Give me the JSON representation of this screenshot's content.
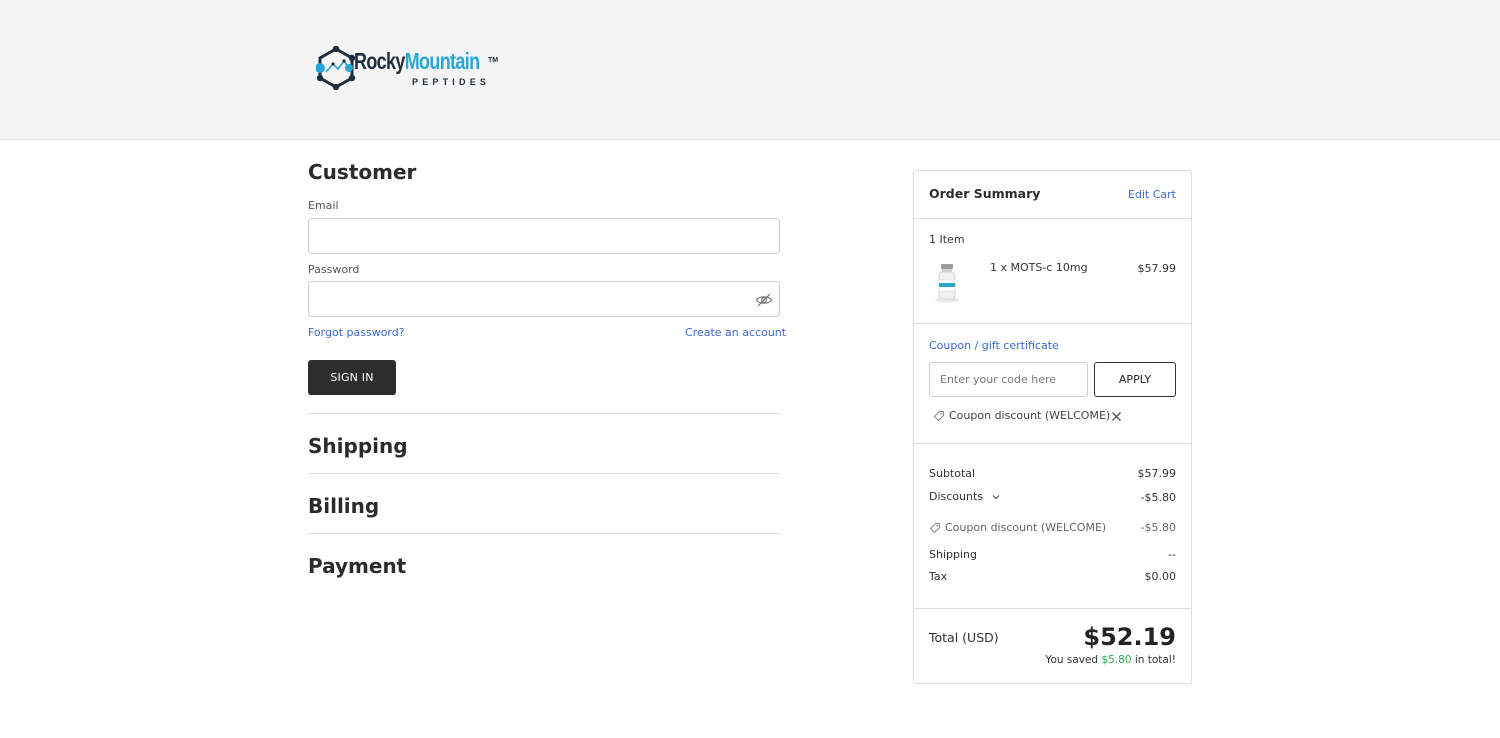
{
  "brand": {
    "logo_word_1": "Rocky",
    "logo_word_2": "Mountain",
    "logo_tm": "TM",
    "logo_sub": "PEPTIDES",
    "colors": {
      "dark": "#1f2d3d",
      "accent": "#2aa6d6"
    }
  },
  "customer": {
    "heading": "Customer",
    "email_label": "Email",
    "email_value": "",
    "password_label": "Password",
    "password_value": "",
    "password_toggle_icon": "eye-off-icon",
    "forgot_password": "Forgot password?",
    "create_account": "Create an account",
    "sign_in": "SIGN IN"
  },
  "sections": {
    "shipping": "Shipping",
    "billing": "Billing",
    "payment": "Payment"
  },
  "summary": {
    "title": "Order Summary",
    "edit_cart": "Edit Cart",
    "item_count": "1 Item",
    "items": [
      {
        "name": "1 x MOTS-c 10mg",
        "price": "$57.99",
        "image_icon": "product-vial-icon"
      }
    ],
    "coupon_link": "Coupon / gift certificate",
    "coupon_placeholder": "Enter your code here",
    "apply": "APPLY",
    "applied_coupon": "Coupon discount (WELCOME)",
    "subtotal_label": "Subtotal",
    "subtotal_value": "$57.99",
    "discounts_label": "Discounts",
    "discounts_value": "-$5.80",
    "discount_line_label": "Coupon discount (WELCOME)",
    "discount_line_value": "-$5.80",
    "shipping_label": "Shipping",
    "shipping_value": "--",
    "tax_label": "Tax",
    "tax_value": "$0.00",
    "total_label": "Total (USD)",
    "total_value": "$52.19",
    "saved_prefix": "You saved",
    "saved_amount": "$5.80",
    "saved_suffix": "in total!",
    "colors": {
      "link": "#3a68c9",
      "saved": "#2aa84a",
      "button": "#2e2e2e"
    }
  }
}
